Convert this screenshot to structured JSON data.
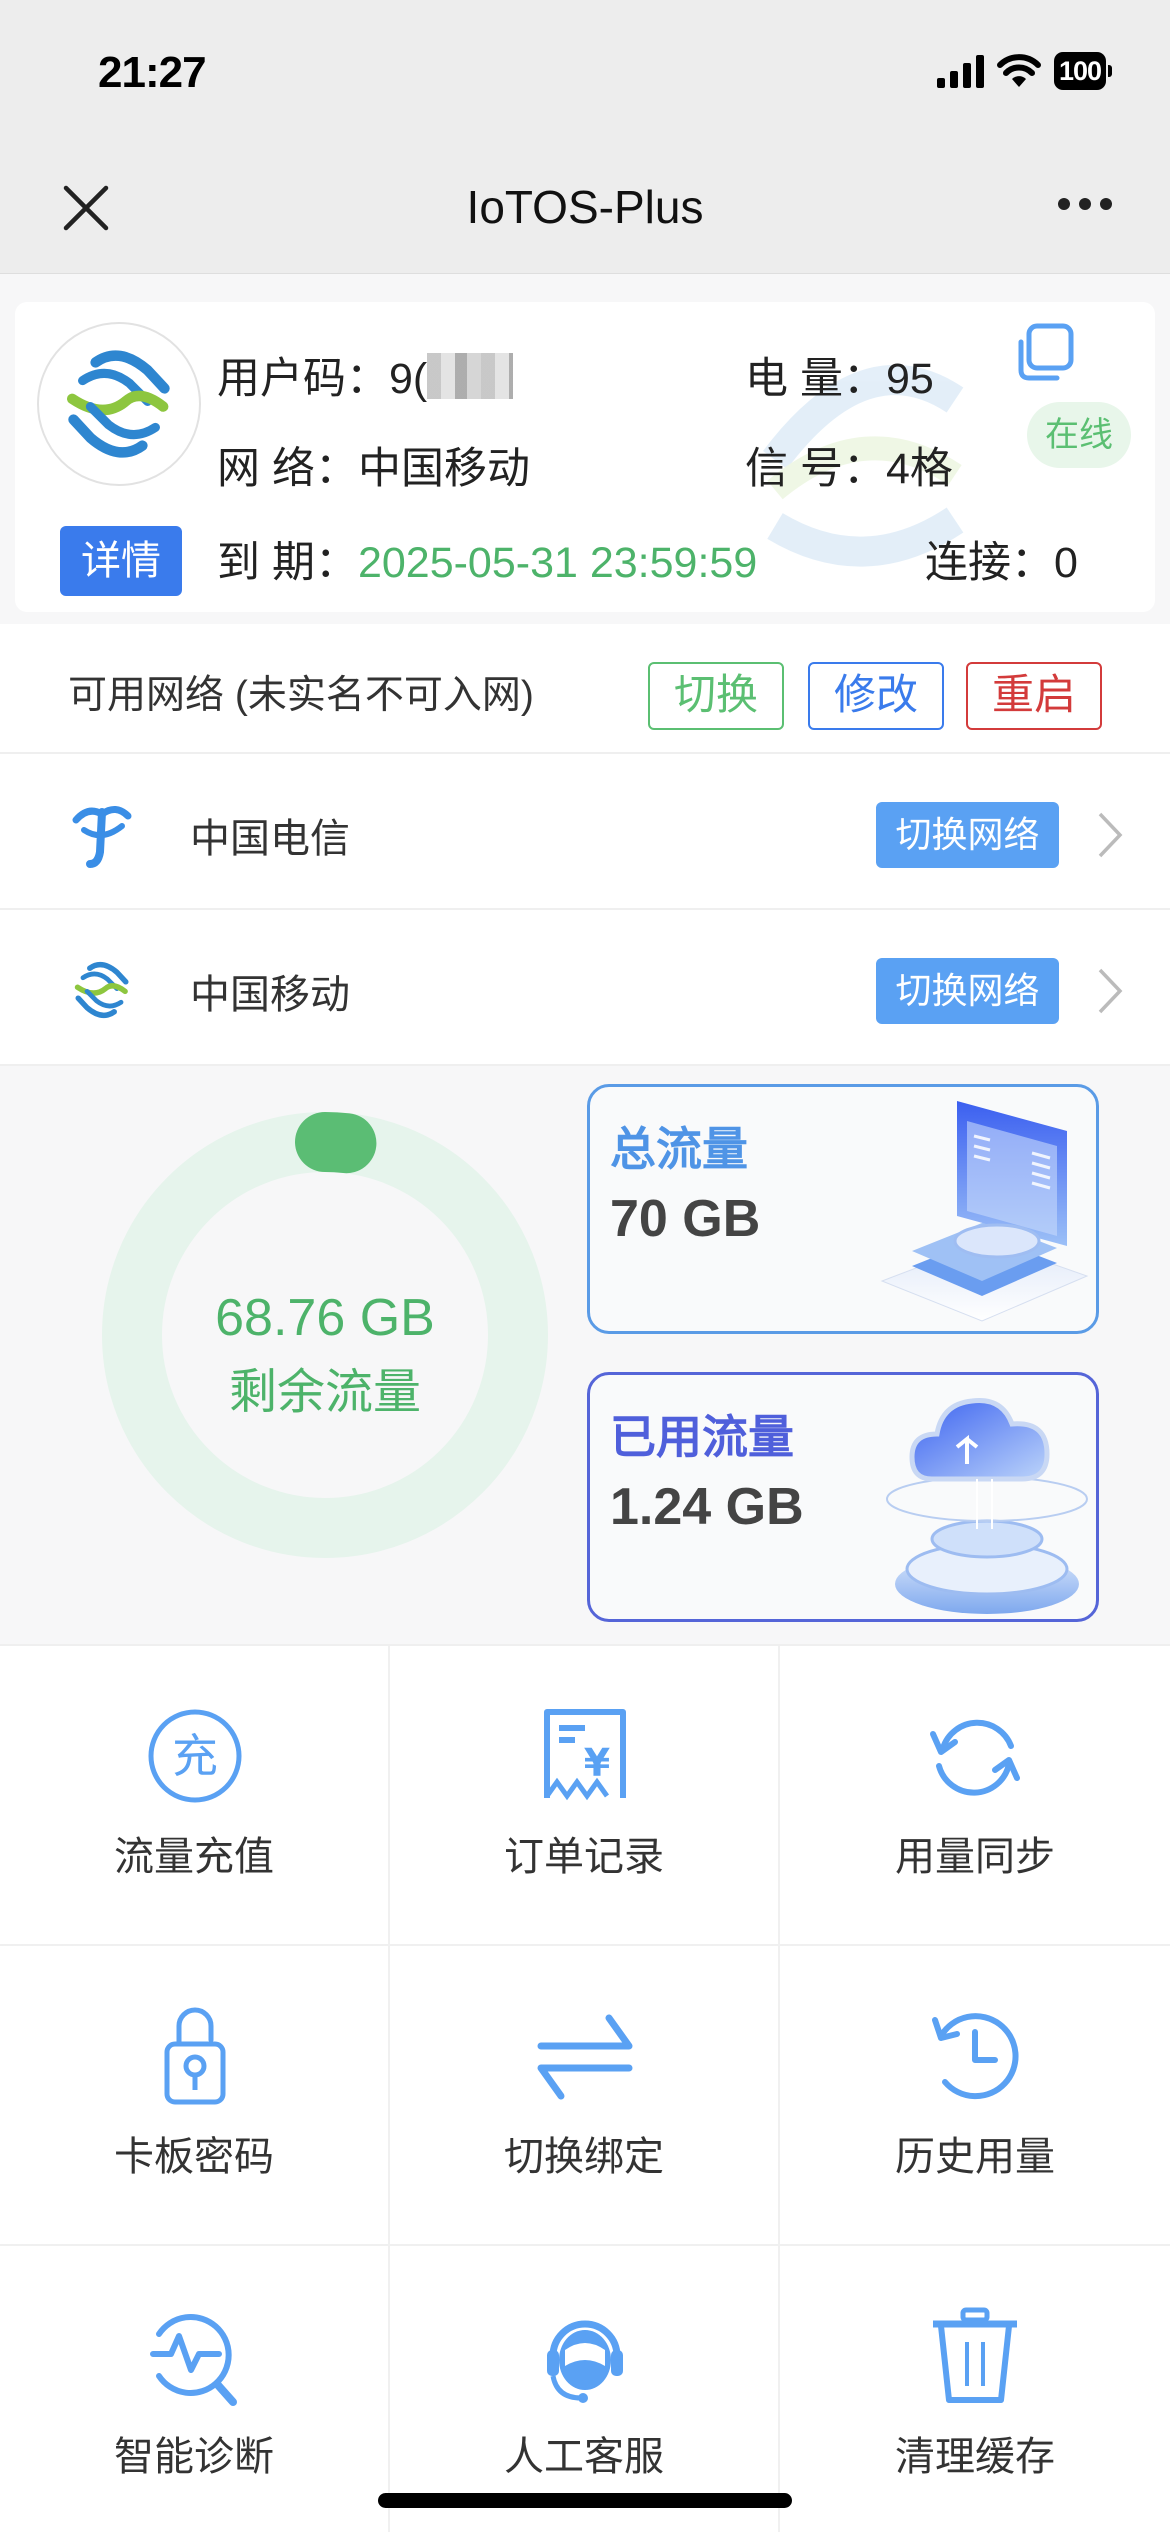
{
  "status_bar": {
    "time": "21:27",
    "battery": "100",
    "icons": [
      "signal-icon",
      "wifi-icon",
      "battery-icon"
    ]
  },
  "navbar": {
    "title": "IoTOS-Plus",
    "close_icon": "close-icon",
    "more_icon": "more-icon"
  },
  "info": {
    "user_code_label": "用户码：",
    "user_code_value": "9(",
    "battery_label": "电  量：",
    "battery_value": "95",
    "network_label": "网    络：",
    "network_value": "中国移动",
    "signal_label": "信  号：",
    "signal_value": "4格",
    "status_badge": "在线",
    "expiry_label": "到    期：",
    "expiry_value": "2025-05-31 23:59:59",
    "connection_label": "连接：",
    "connection_value": "0",
    "detail_button": "详情"
  },
  "networks": {
    "title": "可用网络 (未实名不可入网)",
    "buttons": {
      "switch": "切换",
      "modify": "修改",
      "restart": "重启"
    },
    "items": [
      {
        "name": "中国电信",
        "icon": "china-telecom-icon",
        "action": "切换网络"
      },
      {
        "name": "中国移动",
        "icon": "china-mobile-icon",
        "action": "切换网络"
      }
    ]
  },
  "traffic": {
    "remaining_value": "68.76 GB",
    "remaining_label": "剩余流量",
    "used_fraction": 0.0177,
    "total_label": "总流量",
    "total_value": "70 GB",
    "used_label": "已用流量",
    "used_value": "1.24 GB"
  },
  "colors": {
    "accent_blue": "#3a7bec",
    "light_blue": "#5aa1f3",
    "green": "#4db36a",
    "red": "#d33b3b"
  },
  "grid": [
    {
      "label": "流量充值",
      "icon": "recharge-icon"
    },
    {
      "label": "订单记录",
      "icon": "receipt-icon"
    },
    {
      "label": "用量同步",
      "icon": "sync-icon"
    },
    {
      "label": "卡板密码",
      "icon": "lock-icon"
    },
    {
      "label": "切换绑定",
      "icon": "switch-arrows-icon"
    },
    {
      "label": "历史用量",
      "icon": "history-icon"
    },
    {
      "label": "智能诊断",
      "icon": "diagnosis-icon"
    },
    {
      "label": "人工客服",
      "icon": "customer-service-icon"
    },
    {
      "label": "清理缓存",
      "icon": "trash-icon"
    }
  ]
}
